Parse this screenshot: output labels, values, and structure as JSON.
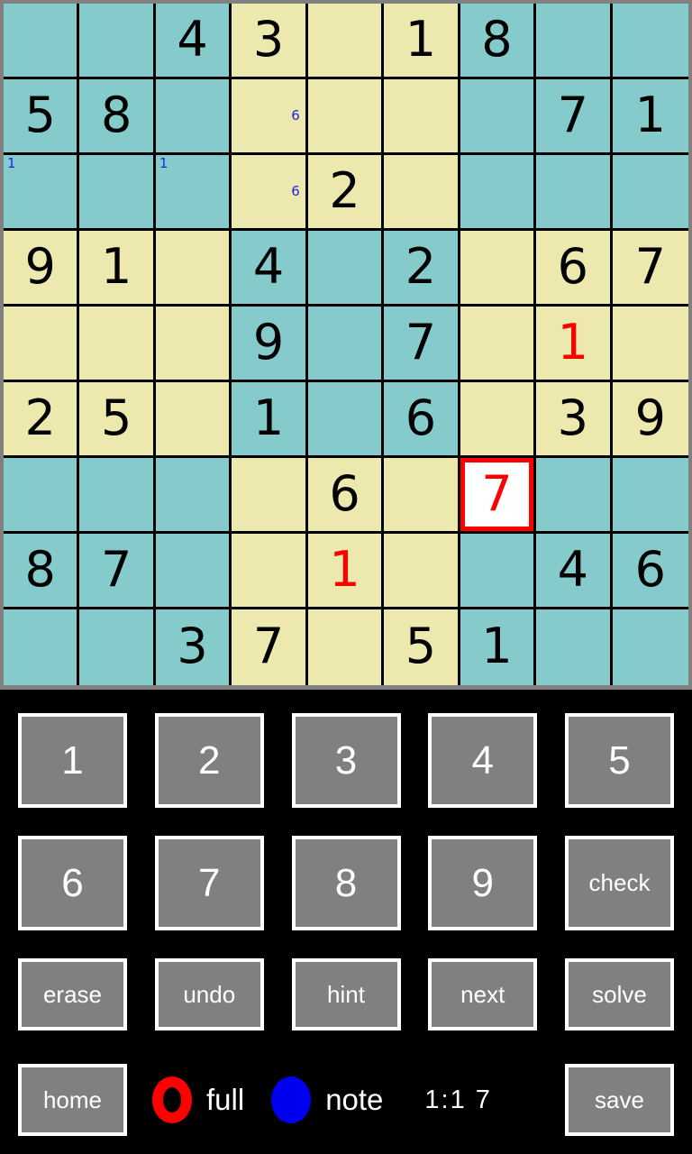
{
  "board": {
    "rows": 9,
    "cols": 9,
    "colors": {
      "teal_block": "#85cbcc",
      "yellow_block": "#ede8ae",
      "grid_line": "#000000",
      "frame": "#808080",
      "given_digit": "#000000",
      "user_digit": "#ff0000",
      "note_digit": "#2222ee",
      "selected_background": "#ffffff",
      "selected_border": "#ff0000"
    },
    "selected_cell": {
      "row": 6,
      "col": 6
    },
    "cells": [
      [
        {
          "value": "",
          "kind": "empty",
          "notes": []
        },
        {
          "value": "",
          "kind": "empty",
          "notes": []
        },
        {
          "value": "4",
          "kind": "given",
          "notes": []
        },
        {
          "value": "3",
          "kind": "given",
          "notes": []
        },
        {
          "value": "",
          "kind": "empty",
          "notes": []
        },
        {
          "value": "1",
          "kind": "given",
          "notes": []
        },
        {
          "value": "8",
          "kind": "given",
          "notes": []
        },
        {
          "value": "",
          "kind": "empty",
          "notes": []
        },
        {
          "value": "",
          "kind": "empty",
          "notes": []
        }
      ],
      [
        {
          "value": "5",
          "kind": "given",
          "notes": []
        },
        {
          "value": "8",
          "kind": "given",
          "notes": []
        },
        {
          "value": "",
          "kind": "empty",
          "notes": []
        },
        {
          "value": "",
          "kind": "empty",
          "notes": [
            "6"
          ]
        },
        {
          "value": "",
          "kind": "empty",
          "notes": []
        },
        {
          "value": "",
          "kind": "empty",
          "notes": []
        },
        {
          "value": "",
          "kind": "empty",
          "notes": []
        },
        {
          "value": "7",
          "kind": "given",
          "notes": []
        },
        {
          "value": "1",
          "kind": "given",
          "notes": []
        }
      ],
      [
        {
          "value": "",
          "kind": "empty",
          "notes": [
            "1"
          ]
        },
        {
          "value": "",
          "kind": "empty",
          "notes": []
        },
        {
          "value": "",
          "kind": "empty",
          "notes": [
            "1"
          ]
        },
        {
          "value": "",
          "kind": "empty",
          "notes": [
            "6"
          ]
        },
        {
          "value": "2",
          "kind": "given",
          "notes": []
        },
        {
          "value": "",
          "kind": "empty",
          "notes": []
        },
        {
          "value": "",
          "kind": "empty",
          "notes": []
        },
        {
          "value": "",
          "kind": "empty",
          "notes": []
        },
        {
          "value": "",
          "kind": "empty",
          "notes": []
        }
      ],
      [
        {
          "value": "9",
          "kind": "given",
          "notes": []
        },
        {
          "value": "1",
          "kind": "given",
          "notes": []
        },
        {
          "value": "",
          "kind": "empty",
          "notes": []
        },
        {
          "value": "4",
          "kind": "given",
          "notes": []
        },
        {
          "value": "",
          "kind": "empty",
          "notes": []
        },
        {
          "value": "2",
          "kind": "given",
          "notes": []
        },
        {
          "value": "",
          "kind": "empty",
          "notes": []
        },
        {
          "value": "6",
          "kind": "given",
          "notes": []
        },
        {
          "value": "7",
          "kind": "given",
          "notes": []
        }
      ],
      [
        {
          "value": "",
          "kind": "empty",
          "notes": []
        },
        {
          "value": "",
          "kind": "empty",
          "notes": []
        },
        {
          "value": "",
          "kind": "empty",
          "notes": []
        },
        {
          "value": "9",
          "kind": "given",
          "notes": []
        },
        {
          "value": "",
          "kind": "empty",
          "notes": []
        },
        {
          "value": "7",
          "kind": "given",
          "notes": []
        },
        {
          "value": "",
          "kind": "empty",
          "notes": []
        },
        {
          "value": "1",
          "kind": "user",
          "notes": []
        },
        {
          "value": "",
          "kind": "empty",
          "notes": []
        }
      ],
      [
        {
          "value": "2",
          "kind": "given",
          "notes": []
        },
        {
          "value": "5",
          "kind": "given",
          "notes": []
        },
        {
          "value": "",
          "kind": "empty",
          "notes": []
        },
        {
          "value": "1",
          "kind": "given",
          "notes": []
        },
        {
          "value": "",
          "kind": "empty",
          "notes": []
        },
        {
          "value": "6",
          "kind": "given",
          "notes": []
        },
        {
          "value": "",
          "kind": "empty",
          "notes": []
        },
        {
          "value": "3",
          "kind": "given",
          "notes": []
        },
        {
          "value": "9",
          "kind": "given",
          "notes": []
        }
      ],
      [
        {
          "value": "",
          "kind": "empty",
          "notes": []
        },
        {
          "value": "",
          "kind": "empty",
          "notes": []
        },
        {
          "value": "",
          "kind": "empty",
          "notes": []
        },
        {
          "value": "",
          "kind": "empty",
          "notes": []
        },
        {
          "value": "6",
          "kind": "given",
          "notes": []
        },
        {
          "value": "",
          "kind": "empty",
          "notes": []
        },
        {
          "value": "7",
          "kind": "user",
          "notes": []
        },
        {
          "value": "",
          "kind": "empty",
          "notes": []
        },
        {
          "value": "",
          "kind": "empty",
          "notes": []
        }
      ],
      [
        {
          "value": "8",
          "kind": "given",
          "notes": []
        },
        {
          "value": "7",
          "kind": "given",
          "notes": []
        },
        {
          "value": "",
          "kind": "empty",
          "notes": []
        },
        {
          "value": "",
          "kind": "empty",
          "notes": []
        },
        {
          "value": "1",
          "kind": "user",
          "notes": []
        },
        {
          "value": "",
          "kind": "empty",
          "notes": []
        },
        {
          "value": "",
          "kind": "empty",
          "notes": []
        },
        {
          "value": "4",
          "kind": "given",
          "notes": []
        },
        {
          "value": "6",
          "kind": "given",
          "notes": []
        }
      ],
      [
        {
          "value": "",
          "kind": "empty",
          "notes": []
        },
        {
          "value": "",
          "kind": "empty",
          "notes": []
        },
        {
          "value": "3",
          "kind": "given",
          "notes": []
        },
        {
          "value": "7",
          "kind": "given",
          "notes": []
        },
        {
          "value": "",
          "kind": "empty",
          "notes": []
        },
        {
          "value": "5",
          "kind": "given",
          "notes": []
        },
        {
          "value": "1",
          "kind": "given",
          "notes": []
        },
        {
          "value": "",
          "kind": "empty",
          "notes": []
        },
        {
          "value": "",
          "kind": "empty",
          "notes": []
        }
      ]
    ]
  },
  "controls": {
    "numbers_row1": [
      "1",
      "2",
      "3",
      "4",
      "5"
    ],
    "numbers_row2": [
      "6",
      "7",
      "8",
      "9"
    ],
    "check_label": "check",
    "actions": [
      "erase",
      "undo",
      "hint",
      "next",
      "solve"
    ],
    "home_label": "home",
    "save_label": "save",
    "mode_full_label": "full",
    "mode_note_label": "note",
    "mode_full_icon": "red-ring-icon",
    "mode_note_icon": "blue-disc-icon",
    "timer": "1:1 7"
  }
}
